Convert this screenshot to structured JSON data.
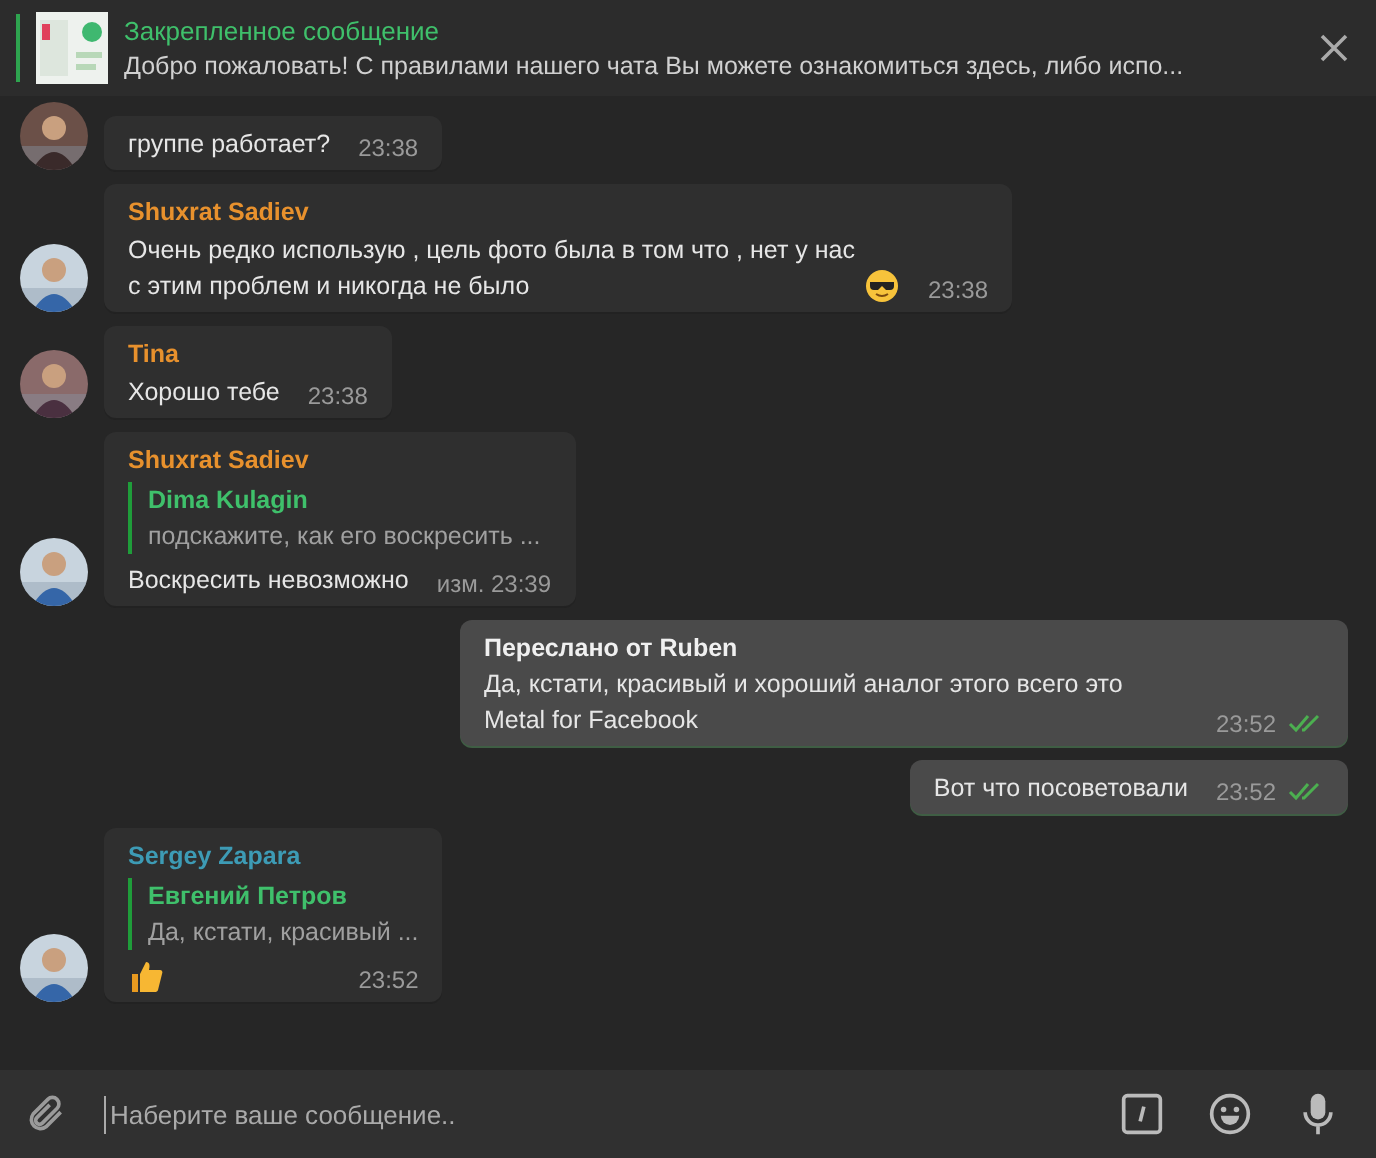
{
  "pinned": {
    "title": "Закрепленное сообщение",
    "text": "Добро пожаловать! С правилами нашего чата Вы можете ознакомиться здесь, либо испо..."
  },
  "messages": [
    {
      "kind": "incoming",
      "text": "группе работает?",
      "time": "23:38"
    },
    {
      "kind": "incoming",
      "author": "Shuxrat Sadiev",
      "color": "#e8912d",
      "text": "Очень редко использую , цель фото была в том что , нет у нас с этим проблем и никогда не было",
      "emoji": {
        "kind": "cool"
      },
      "time": "23:38"
    },
    {
      "kind": "incoming",
      "author": "Tina",
      "color": "#e8912d",
      "text": "Хорошо тебе",
      "time": "23:38"
    },
    {
      "kind": "incoming",
      "author": "Shuxrat Sadiev",
      "color": "#e8912d",
      "reply": {
        "author": "Dima Kulagin",
        "text": "подскажите, как его воскресить ..."
      },
      "text": "Воскресить невозможно",
      "time": "изм. 23:39"
    },
    {
      "kind": "outgoing",
      "forward": "Переслано от Ruben",
      "text": "Да, кстати, красивый и хороший аналог этого всего это Metal for Facebook",
      "time": "23:52",
      "read": true
    },
    {
      "kind": "outgoing",
      "text": "Вот что посоветовали",
      "time": "23:52",
      "read": true
    },
    {
      "kind": "incoming",
      "author": "Sergey Zapara",
      "color": "#3d9bb5",
      "reply": {
        "author": "Евгений Петров",
        "text": "Да, кстати, красивый ..."
      },
      "emoji": {
        "kind": "thumbs"
      },
      "time": "23:52"
    }
  ],
  "input": {
    "placeholder": "Наберите ваше сообщение.."
  }
}
